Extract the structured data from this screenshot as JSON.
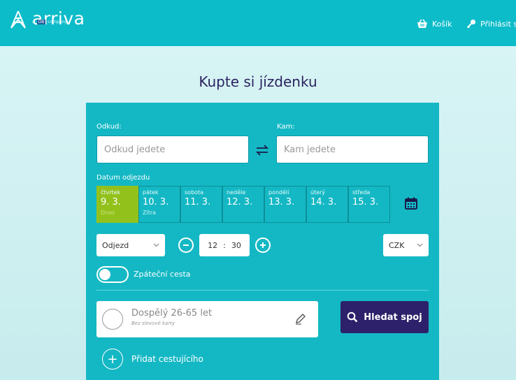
{
  "header": {
    "logo_text": "arriva",
    "logo_sub_prefix": "a",
    "logo_sub_badge": "DB",
    "logo_sub_suffix": "company",
    "cart_label": "Košík",
    "login_label": "Přihlásit se"
  },
  "main": {
    "title": "Kupte si jízdenku"
  },
  "search": {
    "from_label": "Odkud:",
    "from_placeholder": "Odkud jedete",
    "to_label": "Kam:",
    "to_placeholder": "Kam jedete",
    "date_label": "Datum odjezdu",
    "days": [
      {
        "name": "čtvrtek",
        "date": "9. 3.",
        "sub": "Dnes",
        "selected": true
      },
      {
        "name": "pátek",
        "date": "10. 3.",
        "sub": "Zítra"
      },
      {
        "name": "sobota",
        "date": "11. 3.",
        "sub": ""
      },
      {
        "name": "neděle",
        "date": "12. 3.",
        "sub": ""
      },
      {
        "name": "pondělí",
        "date": "13. 3.",
        "sub": ""
      },
      {
        "name": "úterý",
        "date": "14. 3.",
        "sub": ""
      },
      {
        "name": "středa",
        "date": "15. 3.",
        "sub": ""
      }
    ],
    "mode_value": "Odjezd",
    "time_hours": "12",
    "time_sep": ":",
    "time_minutes": "30",
    "currency_value": "CZK",
    "return_label": "Zpáteční cesta",
    "passenger_name": "Dospělý 26-65 let",
    "passenger_discount": "Bez slevové karty",
    "search_button": "Hledat spoj",
    "add_passenger": "Přidat cestujícího"
  },
  "colors": {
    "header": "#0cbcc9",
    "panel": "#14b8c4",
    "selected_day": "#93c11c",
    "search_button": "#2c216a",
    "title": "#2b2360"
  }
}
